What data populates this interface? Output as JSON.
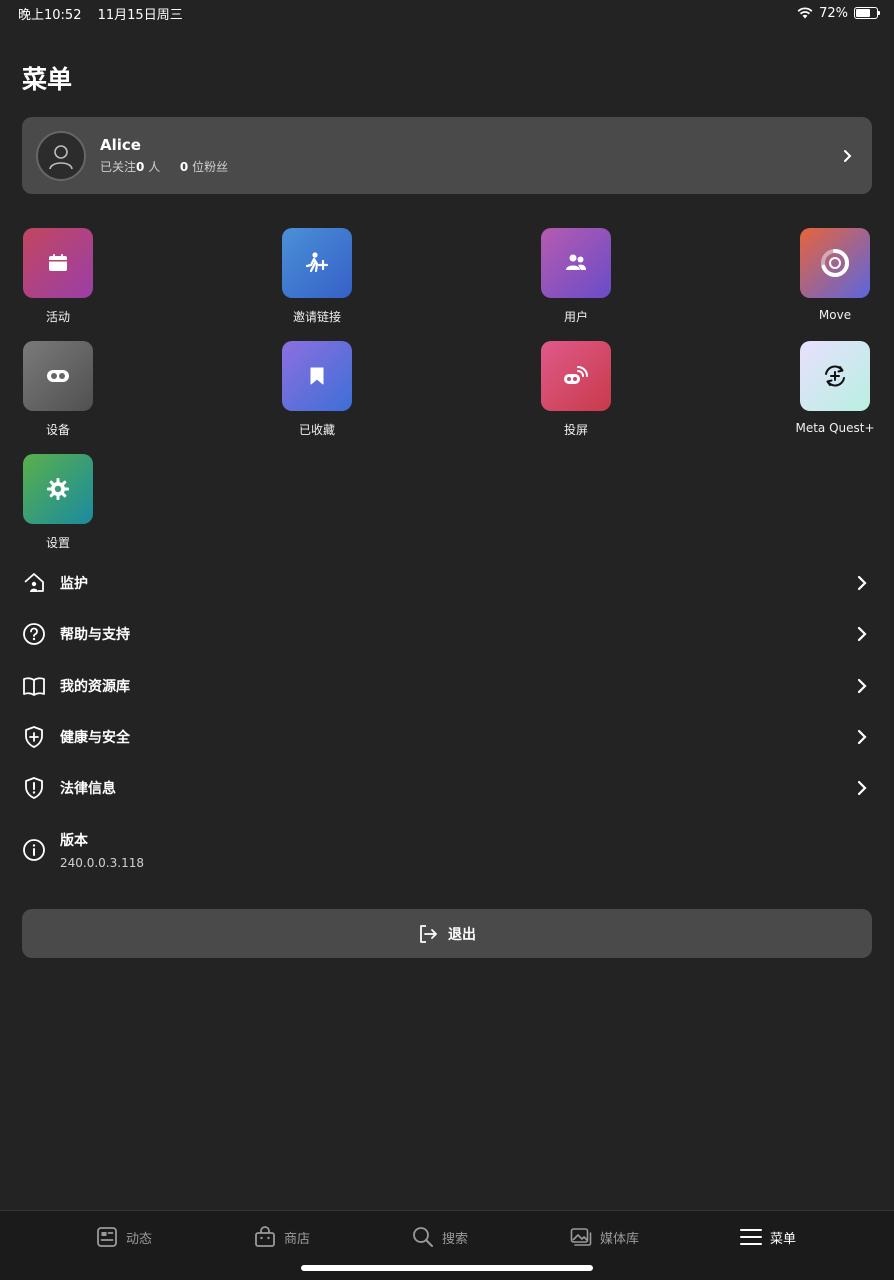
{
  "status_bar": {
    "time": "晚上10:52",
    "date": "11月15日周三",
    "battery": "72%",
    "battery_level": 0.72
  },
  "page_title": "菜单",
  "profile": {
    "name": "Alice",
    "following_prefix": "已关注",
    "following_count": "0",
    "following_suffix": "人",
    "followers_count": "0",
    "followers_suffix": "位粉丝"
  },
  "apps": [
    {
      "label": "活动",
      "icon": "calendar-icon",
      "colors": [
        "#c2465f",
        "#9a3fa8"
      ]
    },
    {
      "label": "邀请链接",
      "icon": "person-add-icon",
      "colors": [
        "#4b90d6",
        "#3560c8"
      ]
    },
    {
      "label": "用户",
      "icon": "people-icon",
      "colors": [
        "#b65bb0",
        "#6a4cc8"
      ]
    },
    {
      "label": "Move",
      "icon": "move-ring-icon",
      "colors": [
        "#e8643a",
        "#5a66e0"
      ]
    },
    {
      "label": "设备",
      "icon": "headset-icon",
      "colors": [
        "#7a7a7a",
        "#505050"
      ]
    },
    {
      "label": "已收藏",
      "icon": "bookmark-icon",
      "colors": [
        "#8d6fe0",
        "#3d6fd6"
      ]
    },
    {
      "label": "投屏",
      "icon": "cast-icon",
      "colors": [
        "#e05a8a",
        "#c83a4a"
      ]
    },
    {
      "label": "Meta Quest+",
      "icon": "quest-plus-icon",
      "colors": [
        "#e8e0ff",
        "#b8f0e0"
      ]
    },
    {
      "label": "设置",
      "icon": "gear-icon",
      "colors": [
        "#5ab04a",
        "#1a8aa0"
      ]
    }
  ],
  "menu": [
    {
      "label": "监护",
      "icon": "home-person-icon"
    },
    {
      "label": "帮助与支持",
      "icon": "help-icon"
    },
    {
      "label": "我的资源库",
      "icon": "book-icon"
    },
    {
      "label": "健康与安全",
      "icon": "shield-plus-icon"
    },
    {
      "label": "法律信息",
      "icon": "shield-alert-icon"
    }
  ],
  "version": {
    "label": "版本",
    "value": "240.0.0.3.118",
    "icon": "info-icon"
  },
  "logout_label": "退出",
  "tabs": [
    {
      "label": "动态",
      "icon": "feed-icon",
      "active": false
    },
    {
      "label": "商店",
      "icon": "store-icon",
      "active": false
    },
    {
      "label": "搜索",
      "icon": "search-icon",
      "active": false
    },
    {
      "label": "媒体库",
      "icon": "media-icon",
      "active": false
    },
    {
      "label": "菜单",
      "icon": "menu-icon",
      "active": true
    }
  ]
}
